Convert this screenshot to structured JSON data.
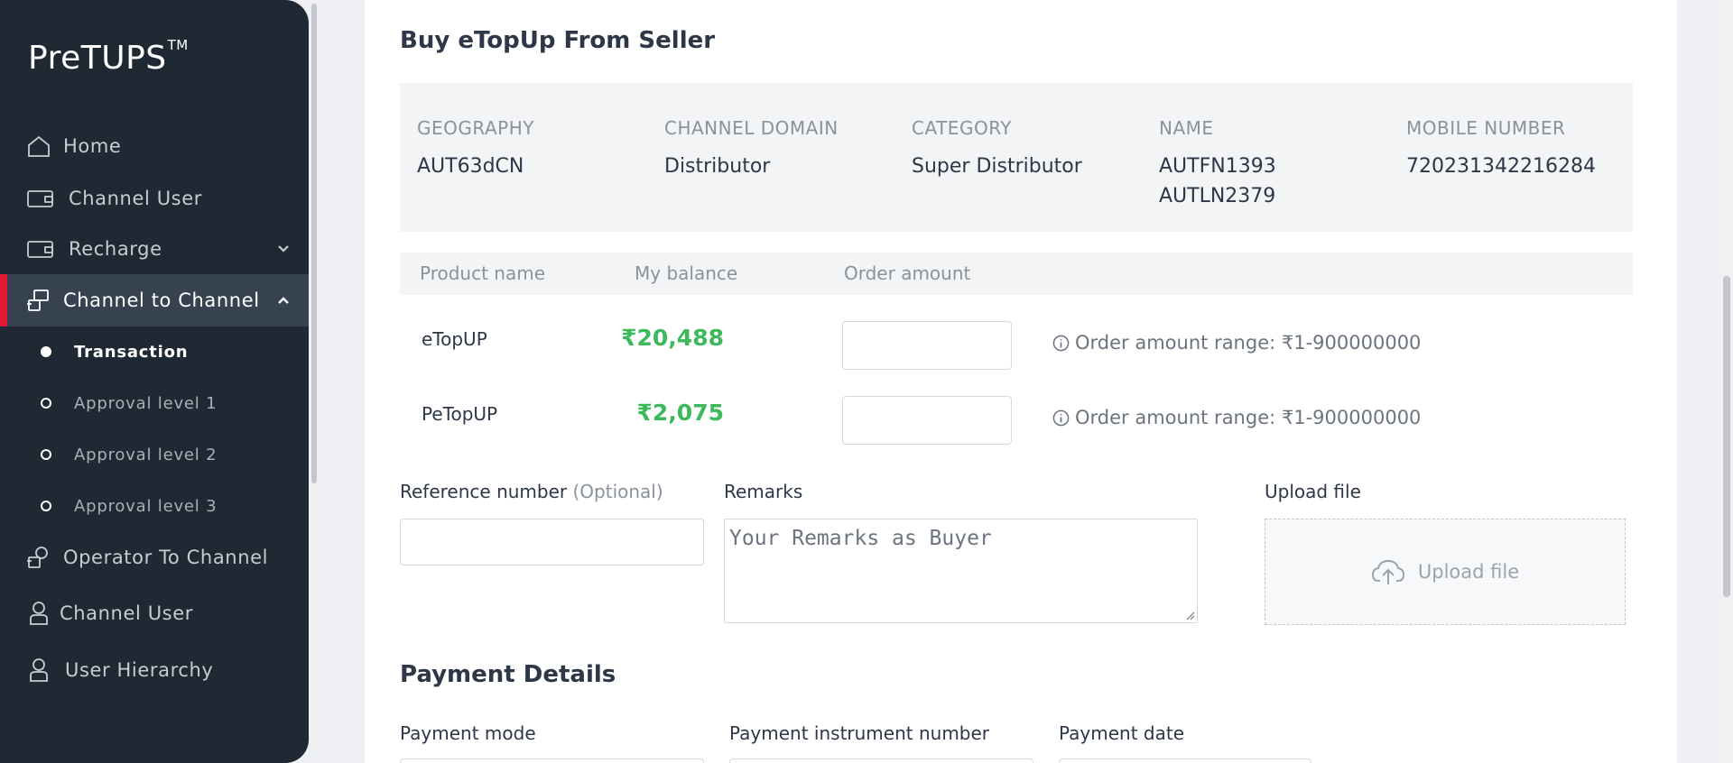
{
  "app": {
    "logo": "PreTUPS",
    "logo_tm": "TM"
  },
  "sidebar": {
    "items": [
      {
        "label": "Home"
      },
      {
        "label": "Channel User"
      },
      {
        "label": "Recharge"
      },
      {
        "label": "Channel to Channel"
      },
      {
        "label": "Operator To Channel"
      },
      {
        "label": "Channel User"
      },
      {
        "label": "User Hierarchy"
      }
    ],
    "sub_items": [
      {
        "label": "Transaction"
      },
      {
        "label": "Approval level 1"
      },
      {
        "label": "Approval level 2"
      },
      {
        "label": "Approval level 3"
      }
    ]
  },
  "page": {
    "title": "Buy eTopUp From Seller"
  },
  "seller": {
    "geography_label": "GEOGRAPHY",
    "geography": "AUT63dCN",
    "domain_label": "CHANNEL DOMAIN",
    "domain": "Distributor",
    "category_label": "CATEGORY",
    "category": "Super Distributor",
    "name_label": "NAME",
    "name_line1": "AUTFN1393",
    "name_line2": "AUTLN2379",
    "mobile_label": "MOBILE NUMBER",
    "mobile": "720231342216284"
  },
  "products": {
    "headers": {
      "name": "Product name",
      "balance": "My balance",
      "order": "Order amount"
    },
    "rows": [
      {
        "name": "eTopUP",
        "balance": "₹20,488",
        "order_value": "",
        "range": "Order amount range: ₹1-900000000"
      },
      {
        "name": "PeTopUP",
        "balance": "₹2,075",
        "order_value": "",
        "range": "Order amount range: ₹1-900000000"
      }
    ]
  },
  "form": {
    "reference_label": "Reference number",
    "reference_optional": "(Optional)",
    "reference_value": "",
    "remarks_label": "Remarks",
    "remarks_placeholder": "Your Remarks as Buyer",
    "upload_label": "Upload file",
    "upload_button": "Upload file"
  },
  "payment": {
    "title": "Payment Details",
    "mode_label": "Payment mode",
    "instrument_label": "Payment instrument number",
    "date_label": "Payment date"
  },
  "colors": {
    "accent": "#e31837",
    "sidebar_bg": "#1f2933",
    "balance_green": "#3cba5b"
  }
}
